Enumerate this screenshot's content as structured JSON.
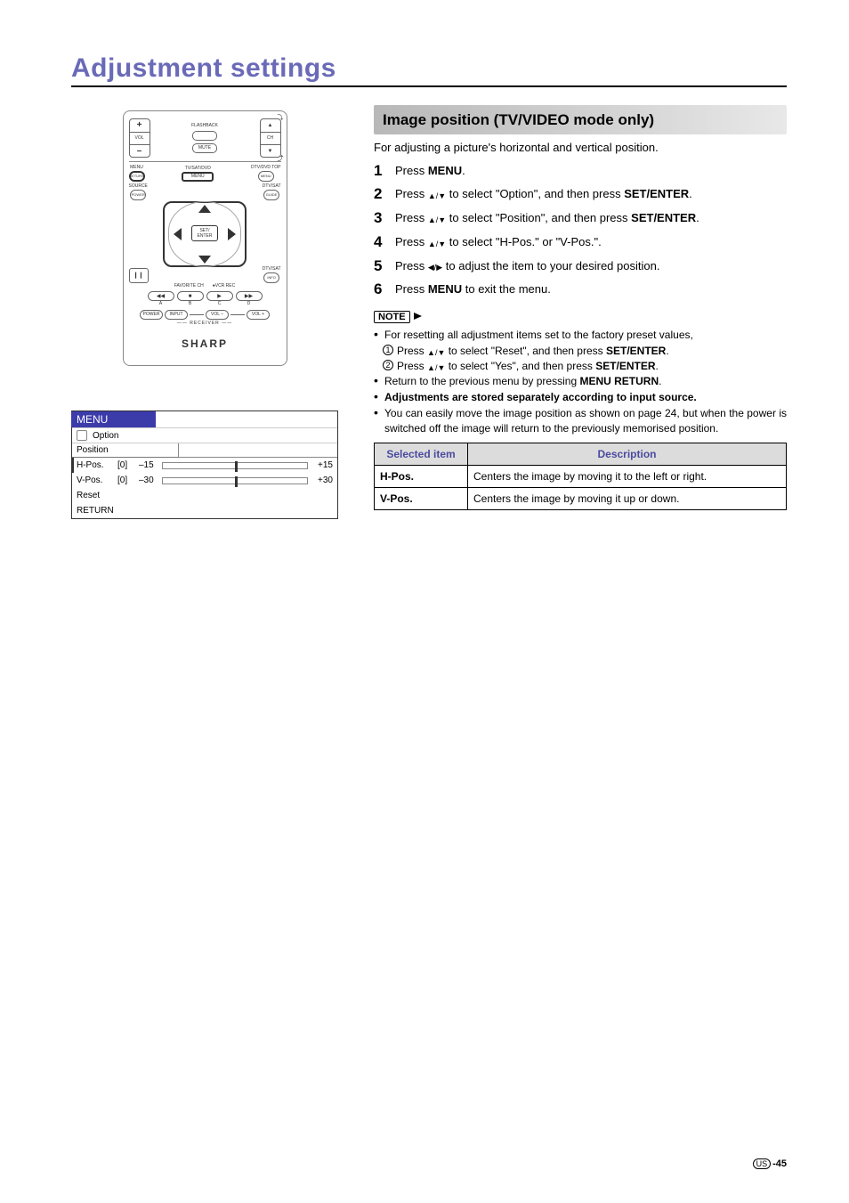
{
  "page_title": "Adjustment settings",
  "remote": {
    "vol_label": "VOL",
    "ch_label": "CH",
    "plus": "+",
    "minus": "–",
    "flashback": "FLASHBACK",
    "mute": "MUTE",
    "menu": "MENU",
    "tvsatdvd": "TV/SAT/DVD",
    "dtvdvdtop": "DTV/DVD TOP",
    "menu_btn": "MENU",
    "return": "RETURN",
    "source": "SOURCE",
    "dtvsat_r": "DTV/SAT",
    "power": "POWER",
    "guide": "GUIDE",
    "set_enter": "SET/\nENTER",
    "dtvsat2": "DTV/SAT",
    "info": "INFO",
    "pause": "❙❙",
    "favorite": "FAVORITE CH",
    "vcrrec": "VCR REC",
    "rec_dot": "●",
    "t_rew": "◀◀",
    "t_stop": "■",
    "t_play": "▶",
    "t_ff": "▶▶",
    "la": "A",
    "lb": "B",
    "lc": "C",
    "ld": "D",
    "rec_power": "POWER",
    "rec_input": "INPUT",
    "rec_volm": "VOL –",
    "rec_volp": "VOL +",
    "receiver": "RECEIVER",
    "brand": "SHARP",
    "up": "▲",
    "down": "▼"
  },
  "menu_panel": {
    "title": "MENU",
    "option": "Option",
    "position": "Position",
    "rows": [
      {
        "name": "H-Pos.",
        "val": "[0]",
        "min": "–15",
        "max": "+15",
        "handle_pct": 50
      },
      {
        "name": "V-Pos.",
        "val": "[0]",
        "min": "–30",
        "max": "+30",
        "handle_pct": 50
      }
    ],
    "reset": "Reset",
    "return": "RETURN"
  },
  "section_heading": "Image position (TV/VIDEO mode only)",
  "intro": "For adjusting a picture's horizontal and vertical position.",
  "steps": [
    {
      "n": "1",
      "pre": "Press ",
      "bold": "MENU",
      "post": "."
    },
    {
      "n": "2",
      "pre": "Press ",
      "ud": true,
      "mid": " to select \"Option\", and then press ",
      "bold": "SET/ENTER",
      "post": "."
    },
    {
      "n": "3",
      "pre": "Press ",
      "ud": true,
      "mid": " to select \"Position\", and then press ",
      "bold": "SET/ENTER",
      "post": "."
    },
    {
      "n": "4",
      "pre": "Press ",
      "ud": true,
      "mid": " to select \"H-Pos.\" or \"V-Pos.\".",
      "bold": "",
      "post": ""
    },
    {
      "n": "5",
      "pre": "Press ",
      "lr": true,
      "mid": " to adjust the item to your desired position.",
      "bold": "",
      "post": ""
    },
    {
      "n": "6",
      "pre": "Press ",
      "bold": "MENU",
      "post": " to exit the menu."
    }
  ],
  "note_label": "NOTE",
  "notes": {
    "bullet1": "For resetting all adjustment items set to the factory preset values,",
    "sub1_pre": "Press ",
    "sub1_mid": " to select \"Reset\", and then press ",
    "sub1_bold": "SET/ENTER",
    "sub1_post": ".",
    "sub2_pre": "Press ",
    "sub2_mid": " to select \"Yes\", and then press ",
    "sub2_bold": "SET/ENTER",
    "sub2_post": ".",
    "bullet2_pre": "Return to the previous menu by pressing ",
    "bullet2_bold": "MENU RETURN",
    "bullet2_post": ".",
    "bullet3": "Adjustments are stored separately according to input source.",
    "bullet4": "You can easily move the image position as shown on page 24, but when the power is switched off the image will return to the previously memorised position."
  },
  "table": {
    "h1": "Selected item",
    "h2": "Description",
    "rows": [
      {
        "item": "H-Pos.",
        "desc": "Centers the image by moving it to the left or right."
      },
      {
        "item": "V-Pos.",
        "desc": "Centers the image by moving it up or down."
      }
    ]
  },
  "footer": {
    "region": "US",
    "page": "-45"
  }
}
